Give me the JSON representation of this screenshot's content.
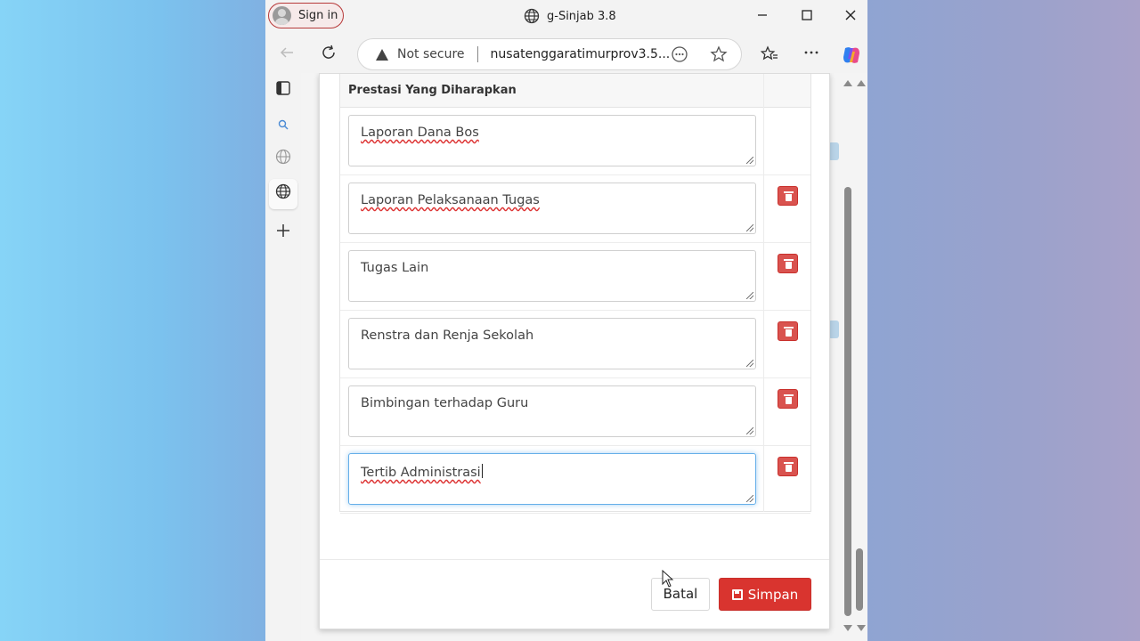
{
  "browser": {
    "signin_label": "Sign in",
    "tab_title": "g-Sinjab 3.8",
    "security_label": "Not secure",
    "url": "nusatenggaratimurprov3.5..."
  },
  "icons": {
    "minimize": "minimize-icon",
    "maximize": "maximize-icon",
    "close": "close-icon",
    "back": "back-icon",
    "refresh": "refresh-icon",
    "warning": "warning-icon",
    "more": "more-icon",
    "favorite": "star-icon",
    "favorites": "favorites-icon",
    "menu": "ellipsis-icon",
    "copilot": "copilot-icon"
  },
  "table": {
    "header": "Prestasi Yang Diharapkan",
    "rows": [
      {
        "value": "Laporan Dana Bos",
        "deletable": false
      },
      {
        "value": "Laporan Pelaksanaan Tugas",
        "deletable": true
      },
      {
        "value": "Tugas Lain",
        "deletable": true
      },
      {
        "value": "Renstra dan Renja Sekolah",
        "deletable": true
      },
      {
        "value": "Bimbingan terhadap Guru",
        "deletable": true
      },
      {
        "value": "Tertib Administrasi",
        "deletable": true,
        "focused": true
      }
    ]
  },
  "footer": {
    "cancel_label": "Batal",
    "save_label": "Simpan"
  },
  "colors": {
    "danger": "#d9342f",
    "focus": "#66afe9"
  }
}
